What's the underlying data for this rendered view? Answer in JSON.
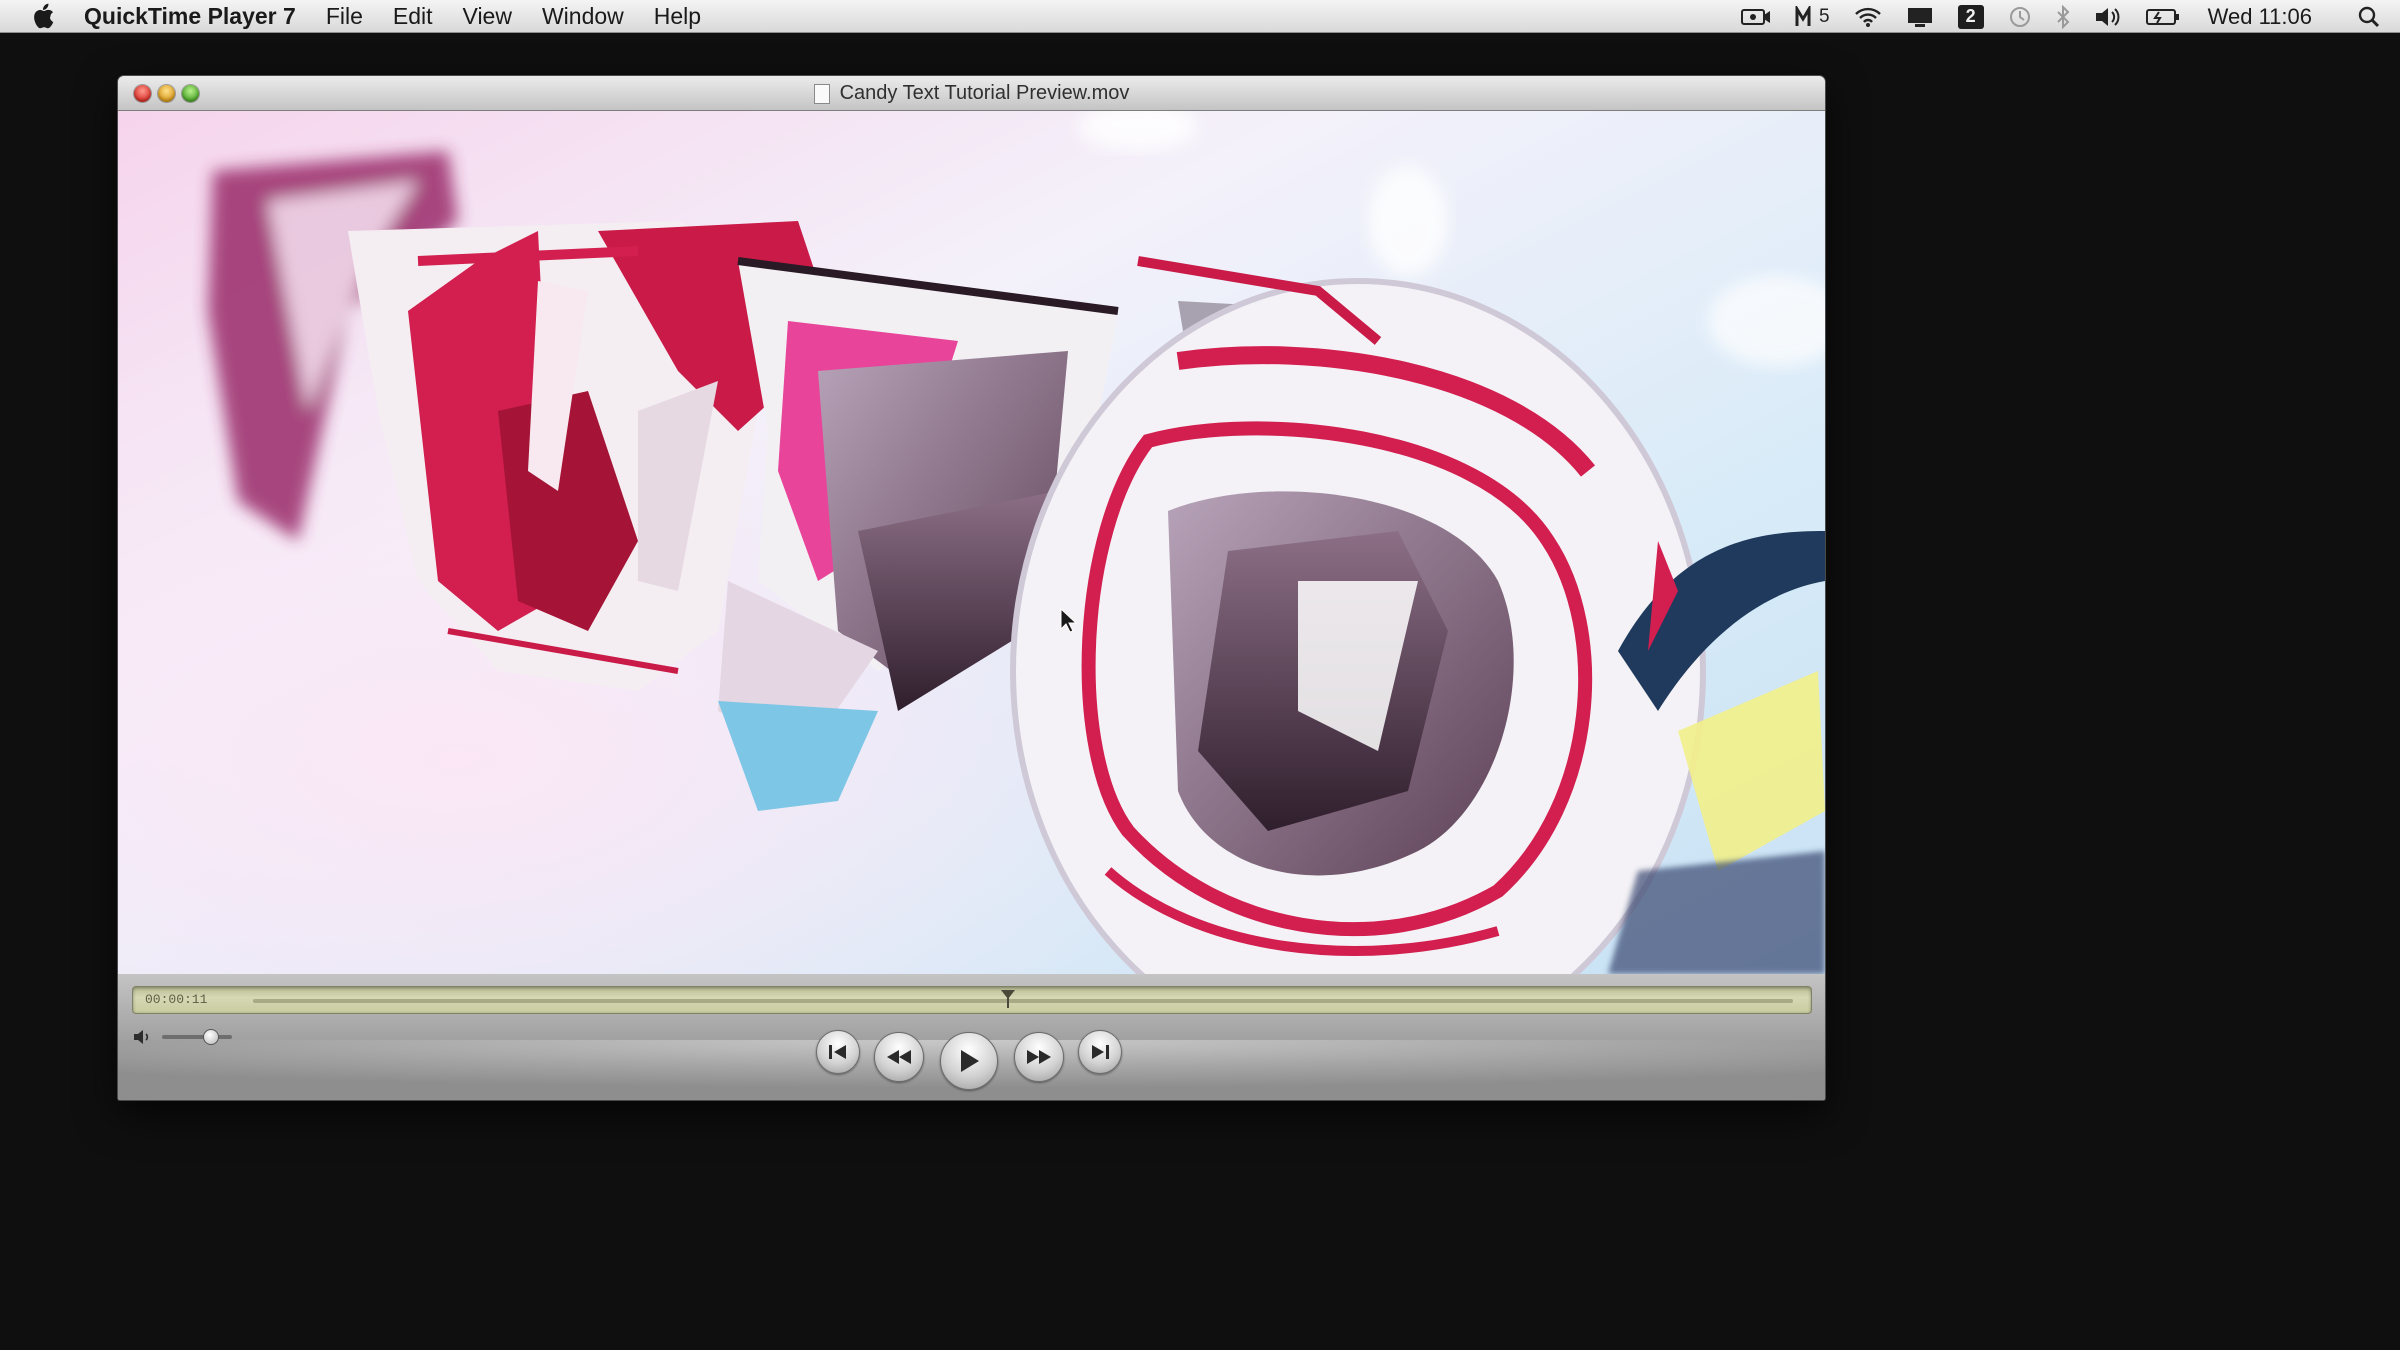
{
  "menubar": {
    "app_name": "QuickTime Player 7",
    "items": [
      "File",
      "Edit",
      "View",
      "Window",
      "Help"
    ],
    "status_battery_count": "5",
    "status_number_badge": "2",
    "clock": "Wed 11:06"
  },
  "window": {
    "title": "Candy Text Tutorial Preview.mov"
  },
  "player": {
    "timecode": "00:00:11",
    "playhead_fraction": 0.49,
    "volume_fraction": 0.7
  },
  "colors": {
    "candy_red": "#d21f4f",
    "candy_pink": "#e8449a",
    "candy_magenta": "#9a2a6a",
    "sky_blue": "#cfe6f6",
    "scrubber_green": "#d6d8b5"
  }
}
